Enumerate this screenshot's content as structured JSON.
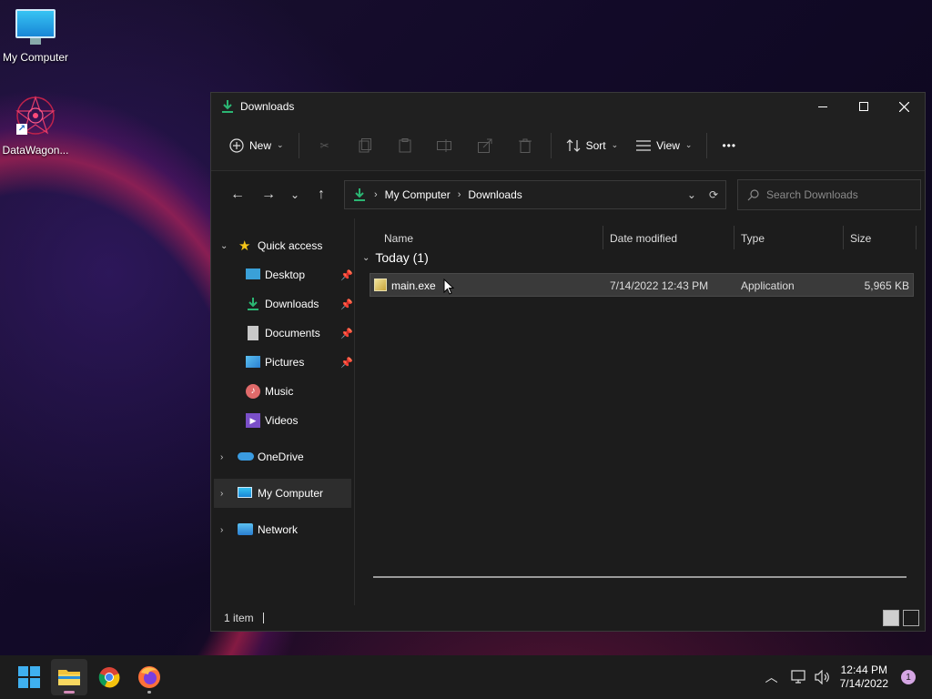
{
  "desktop": {
    "icons": [
      {
        "label": "My Computer"
      },
      {
        "label": "DataWagon..."
      }
    ]
  },
  "window": {
    "title": "Downloads",
    "toolbar": {
      "new_label": "New",
      "sort_label": "Sort",
      "view_label": "View",
      "more_label": "•••"
    },
    "address": {
      "crumbs": [
        "My Computer",
        "Downloads"
      ]
    },
    "search": {
      "placeholder": "Search Downloads"
    },
    "nav": {
      "quick_access": "Quick access",
      "items": [
        {
          "label": "Desktop",
          "pinned": true
        },
        {
          "label": "Downloads",
          "pinned": true
        },
        {
          "label": "Documents",
          "pinned": true
        },
        {
          "label": "Pictures",
          "pinned": true
        },
        {
          "label": "Music",
          "pinned": false
        },
        {
          "label": "Videos",
          "pinned": false
        }
      ],
      "onedrive": "OneDrive",
      "my_computer": "My Computer",
      "network": "Network"
    },
    "columns": {
      "name": "Name",
      "date": "Date modified",
      "type": "Type",
      "size": "Size"
    },
    "group": {
      "label": "Today (1)"
    },
    "files": [
      {
        "name": "main.exe",
        "date": "7/14/2022 12:43 PM",
        "type": "Application",
        "size": "5,965 KB"
      }
    ],
    "status": {
      "count": "1 item"
    }
  },
  "taskbar": {
    "clock_time": "12:44 PM",
    "clock_date": "7/14/2022",
    "notification_count": "1"
  },
  "colors": {
    "accent": "#2bb673",
    "window_bg": "#1c1c1c",
    "selection": "#3a3a3a"
  }
}
